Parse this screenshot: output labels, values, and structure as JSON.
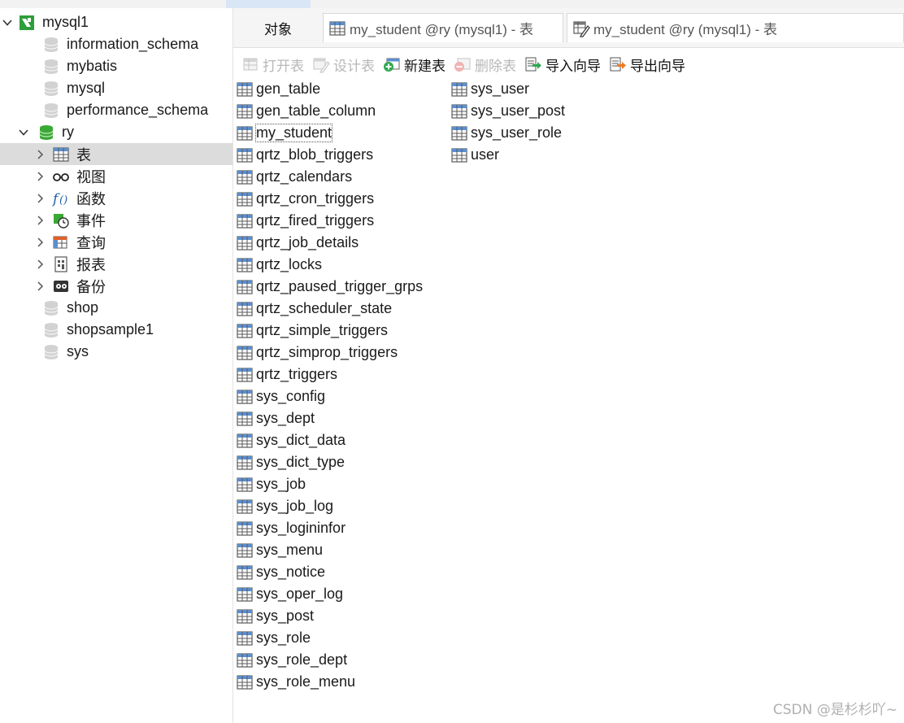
{
  "sidebar": {
    "connection": "mysql1",
    "databases_top": [
      "information_schema",
      "mybatis",
      "mysql",
      "performance_schema"
    ],
    "open_db": "ry",
    "ry_children": [
      {
        "label": "表",
        "icon": "table-icon"
      },
      {
        "label": "视图",
        "icon": "view-glasses-icon"
      },
      {
        "label": "函数",
        "icon": "function-icon"
      },
      {
        "label": "事件",
        "icon": "event-clock-icon"
      },
      {
        "label": "查询",
        "icon": "query-icon"
      },
      {
        "label": "报表",
        "icon": "report-icon"
      },
      {
        "label": "备份",
        "icon": "backup-icon"
      }
    ],
    "databases_bottom": [
      "shop",
      "shopsample1",
      "sys"
    ]
  },
  "tabs": {
    "objects": "对象",
    "tab1": "my_student @ry (mysql1) - 表",
    "tab2": "my_student @ry (mysql1) - 表"
  },
  "toolbar": {
    "open_table": "打开表",
    "design_table": "设计表",
    "new_table": "新建表",
    "delete_table": "删除表",
    "import_wizard": "导入向导",
    "export_wizard": "导出向导"
  },
  "tables_col1": [
    "gen_table",
    "gen_table_column",
    "my_student",
    "qrtz_blob_triggers",
    "qrtz_calendars",
    "qrtz_cron_triggers",
    "qrtz_fired_triggers",
    "qrtz_job_details",
    "qrtz_locks",
    "qrtz_paused_trigger_grps",
    "qrtz_scheduler_state",
    "qrtz_simple_triggers",
    "qrtz_simprop_triggers",
    "qrtz_triggers",
    "sys_config",
    "sys_dept",
    "sys_dict_data",
    "sys_dict_type",
    "sys_job",
    "sys_job_log",
    "sys_logininfor",
    "sys_menu",
    "sys_notice",
    "sys_oper_log",
    "sys_post",
    "sys_role",
    "sys_role_dept",
    "sys_role_menu"
  ],
  "tables_col2": [
    "sys_user",
    "sys_user_post",
    "sys_user_role",
    "user"
  ],
  "focused_table": "my_student",
  "watermark": "CSDN @是杉杉吖~",
  "colors": {
    "selected_row": "#dcdcdc",
    "db_green": "#3aa835",
    "table_blue": "#4a7cc0"
  }
}
